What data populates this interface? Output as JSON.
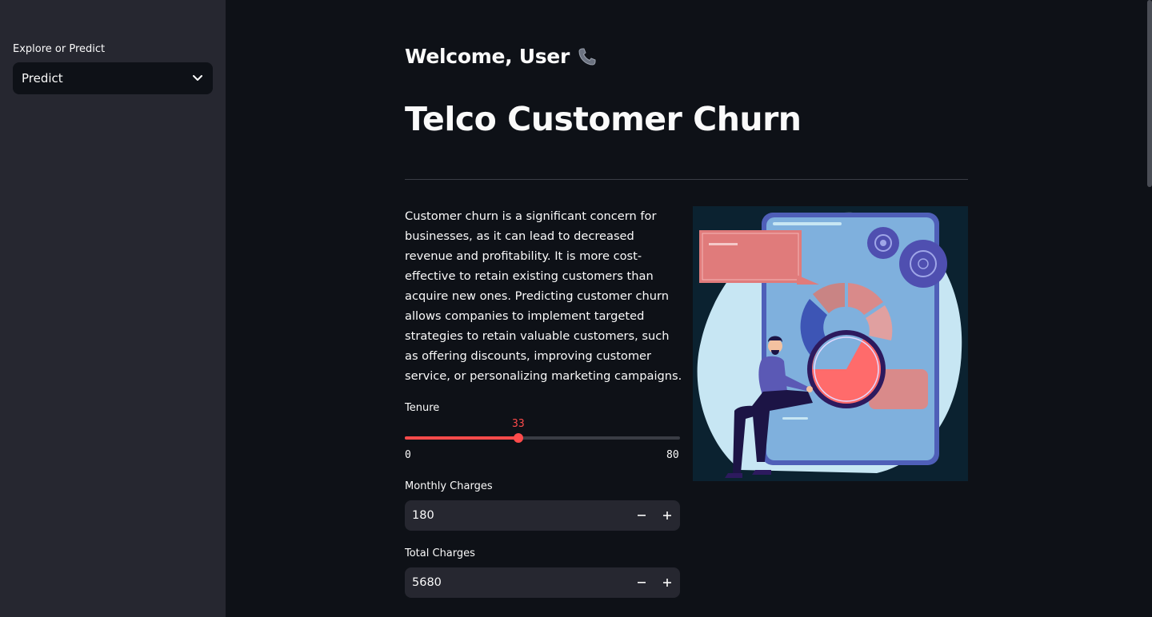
{
  "sidebar": {
    "label": "Explore or Predict",
    "selected": "Predict"
  },
  "main": {
    "welcome": "Welcome, User",
    "title": "Telco Customer Churn",
    "description": "Customer churn is a significant concern for businesses, as it can lead to decreased revenue and profitability. It is more cost-effective to retain existing customers than acquire new ones. Predicting customer churn allows companies to implement targeted strategies to retain valuable customers, such as offering discounts, improving customer service, or personalizing marketing campaigns."
  },
  "tenure": {
    "label": "Tenure",
    "value": 33,
    "min": 0,
    "max": 80
  },
  "monthly": {
    "label": "Monthly Charges",
    "value": "180"
  },
  "total": {
    "label": "Total Charges",
    "value": "5680"
  },
  "colors": {
    "accent": "#ff4b4b",
    "sidebar_bg": "#262730",
    "main_bg": "#0e1117"
  },
  "icons": {
    "welcome": "telephone-icon",
    "select": "chevron-down-icon",
    "decrement": "minus-icon",
    "increment": "plus-icon"
  }
}
